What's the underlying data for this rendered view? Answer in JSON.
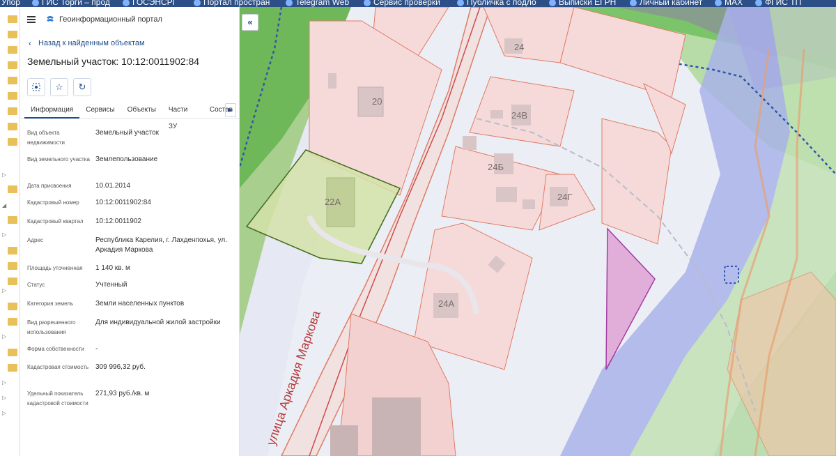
{
  "bookmarks": [
    {
      "label": "Упор"
    },
    {
      "label": "ГИС Торги – прод"
    },
    {
      "label": "ГОСЭНСРГ"
    },
    {
      "label": "Портал простран"
    },
    {
      "label": "Telegram Web"
    },
    {
      "label": "Сервис проверки"
    },
    {
      "label": "Публичка с подло"
    },
    {
      "label": "Выписки ЕГРН"
    },
    {
      "label": "Личный кабинет"
    },
    {
      "label": "MAX"
    },
    {
      "label": "ФГИС ТП"
    }
  ],
  "panel": {
    "app_title": "Геоинформационный портал",
    "back_label": "Назад к найденным объектам",
    "object_title": "Земельный участок: 10:12:0011902:84",
    "tabs": [
      {
        "label": "Информация",
        "active": true
      },
      {
        "label": "Сервисы"
      },
      {
        "label": "Объекты"
      },
      {
        "label": "Части ЗУ"
      },
      {
        "label": "Состав"
      }
    ],
    "fields": [
      {
        "label": "Вид объекта недвижимости",
        "value": "Земельный участок"
      },
      {
        "label": "Вид земельного участка",
        "value": "Землепользование"
      },
      {
        "label": "Дата присвоения",
        "value": "10.01.2014"
      },
      {
        "label": "Кадастровый номер",
        "value": "10:12:0011902:84"
      },
      {
        "label": "Кадастровый квартал",
        "value": "10:12:0011902"
      },
      {
        "label": "Адрес",
        "value": "Республика Карелия, г. Лахденпохья, ул. Аркадия Маркова"
      },
      {
        "label": "Площадь уточненная",
        "value": "1 140 кв. м"
      },
      {
        "label": "Статус",
        "value": "Учтенный"
      },
      {
        "label": "Категория земель",
        "value": "Земли населенных пунктов"
      },
      {
        "label": "Вид разрешенного использования",
        "value": "Для индивидуальной жилой застройки"
      },
      {
        "label": "Форма собственности",
        "value": "-"
      },
      {
        "label": "Кадастровая стоимость",
        "value": "309 996,32 руб."
      },
      {
        "label": "Удельный показатель кадастровой стоимости",
        "value": "271,93 руб./кв. м"
      }
    ]
  },
  "map": {
    "street_label": "улица Аркадия Маркова",
    "parcel_labels": [
      "24",
      "20",
      "24В",
      "24Б",
      "24Г",
      "22А",
      "24А"
    ],
    "collapse_icon": "«"
  },
  "colors": {
    "accent": "#1e4c8f",
    "parcel_stroke": "#e07b63",
    "parcel_fill": "#f6dada",
    "selected_fill": "#d3e2a8",
    "selected_stroke": "#3f6d1c",
    "violet_stroke": "#9b2a98"
  }
}
